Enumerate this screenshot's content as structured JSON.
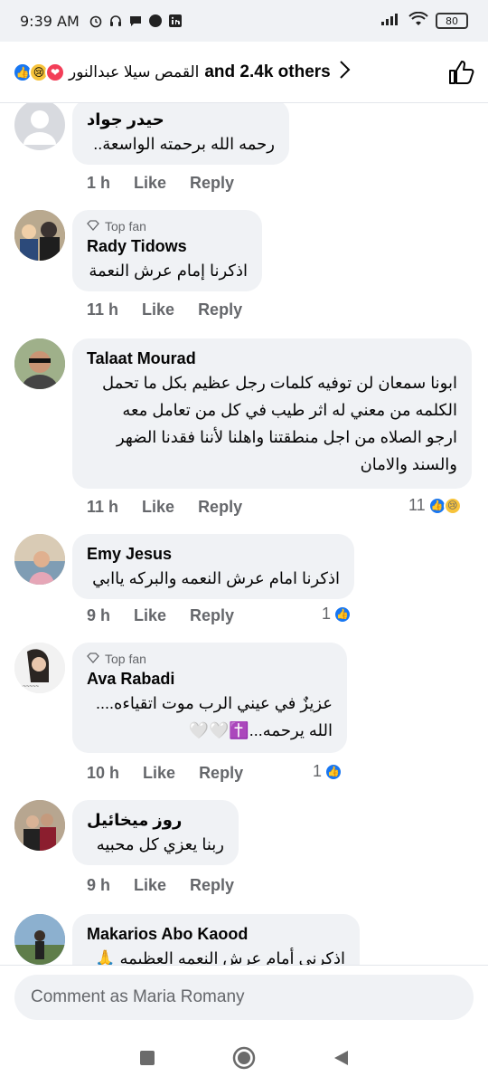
{
  "status_bar": {
    "time": "9:39 AM",
    "battery": "80"
  },
  "reactions": {
    "names": "القمص سيلا عبدالنور",
    "others": "and 2.4k others"
  },
  "comments": [
    {
      "author": "حيدر جواد",
      "text": "رحمه الله برحمته الواسعة..",
      "time": "1 h",
      "like": "Like",
      "reply": "Reply"
    },
    {
      "top_fan": "Top fan",
      "author": "Rady Tidows",
      "text": "اذكرنا إمام عرش النعمة",
      "time": "11 h",
      "like": "Like",
      "reply": "Reply"
    },
    {
      "author": "Talaat Mourad",
      "text_lines": [
        "ابونا سمعان لن توفيه كلمات رجل عظيم بكل ما تحمل",
        "الكلمه من معني له اثر طيب في كل من تعامل معه",
        "ارجو الصلاه من اجل منطقتنا واهلنا لأننا فقدنا الضهر",
        "والسند والامان"
      ],
      "time": "11 h",
      "like": "Like",
      "reply": "Reply",
      "reactions": "11"
    },
    {
      "author": "Emy Jesus",
      "text": "اذكرنا امام عرش النعمه والبركه ياابي",
      "time": "9 h",
      "like": "Like",
      "reply": "Reply",
      "reactions": "1"
    },
    {
      "top_fan": "Top fan",
      "author": "Ava Rabadi",
      "text_lines": [
        "عزيزٌ في عيني الرب موت اتقياءه....",
        "الله يرحمه...✝️🤍🤍"
      ],
      "time": "10 h",
      "like": "Like",
      "reply": "Reply",
      "reactions": "1"
    },
    {
      "author": "روز ميخائيل",
      "text": "ربنا يعزي كل محبيه",
      "time": "9 h",
      "like": "Like",
      "reply": "Reply"
    },
    {
      "author": "Makarios Abo Kaood",
      "text": "اذكرني أمام عرش النعمه العظيمه 🙏"
    }
  ],
  "composer": {
    "placeholder": "Comment as Maria Romany"
  }
}
